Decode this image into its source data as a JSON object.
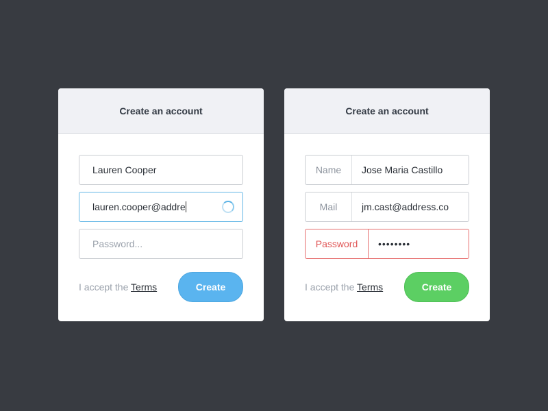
{
  "left_card": {
    "title": "Create an account",
    "name_value": "Lauren Cooper",
    "email_value": "lauren.cooper@addre",
    "password_placeholder": "Password...",
    "terms_prefix": "I accept the",
    "terms_link": "Terms",
    "create_label": "Create",
    "button_color": "#5ab4ef"
  },
  "right_card": {
    "title": "Create an account",
    "name_label": "Name",
    "name_value": "Jose Maria Castillo",
    "mail_label": "Mail",
    "mail_value": "jm.cast@address.co",
    "password_label": "Password",
    "password_value": "••••••••",
    "terms_prefix": "I accept the",
    "terms_link": "Terms",
    "create_label": "Create",
    "button_color": "#5ccf63",
    "error_color": "#e05555"
  }
}
